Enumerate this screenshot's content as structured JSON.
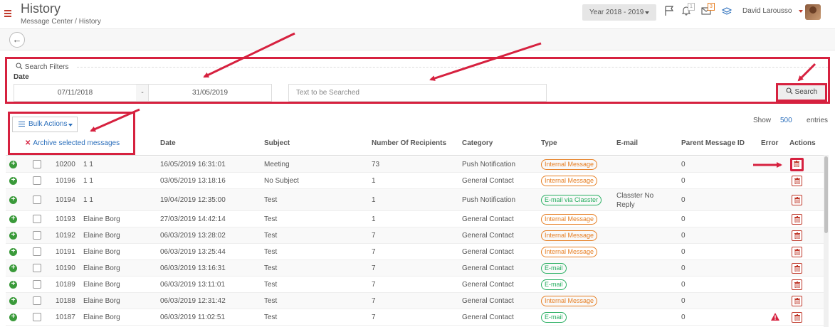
{
  "header": {
    "title": "History",
    "breadcrumb": "Message Center / History",
    "year_select": "Year 2018 - 2019",
    "notif_count": "1",
    "msg_count": "3",
    "user_name": "David Larousso"
  },
  "filters": {
    "label": "Search Filters",
    "date_label": "Date",
    "date_from": "07/11/2018",
    "date_sep": "-",
    "date_to": "31/05/2019",
    "text_placeholder": "Text to be Searched",
    "search_button": "Search"
  },
  "bulk": {
    "button": "Bulk Actions",
    "archive": "Archive selected messages"
  },
  "entries": {
    "show": "Show",
    "count": "500",
    "entries": "entries"
  },
  "table": {
    "headers": {
      "date": "Date",
      "subject": "Subject",
      "recipients": "Number Of Recipients",
      "category": "Category",
      "type": "Type",
      "email": "E-mail",
      "parent": "Parent Message ID",
      "error": "Error",
      "actions": "Actions"
    },
    "rows": [
      {
        "id": "10200",
        "sender": "1 1",
        "date": "16/05/2019 16:31:01",
        "subject": "Meeting",
        "recipients": "73",
        "category": "Push Notification",
        "type": "Internal Message",
        "email": "",
        "parent": "0"
      },
      {
        "id": "10196",
        "sender": "1 1",
        "date": "03/05/2019 13:18:16",
        "subject": "No Subject",
        "recipients": "1",
        "category": "General Contact",
        "type": "Internal Message",
        "email": "",
        "parent": "0"
      },
      {
        "id": "10194",
        "sender": "1 1",
        "date": "19/04/2019 12:35:00",
        "subject": "Test",
        "recipients": "1",
        "category": "Push Notification",
        "type": "E-mail via Classter",
        "email": "Classter No Reply",
        "parent": "0"
      },
      {
        "id": "10193",
        "sender": "Elaine Borg",
        "date": "27/03/2019 14:42:14",
        "subject": "Test",
        "recipients": "1",
        "category": "General Contact",
        "type": "Internal Message",
        "email": "",
        "parent": "0"
      },
      {
        "id": "10192",
        "sender": "Elaine Borg",
        "date": "06/03/2019 13:28:02",
        "subject": "Test",
        "recipients": "7",
        "category": "General Contact",
        "type": "Internal Message",
        "email": "",
        "parent": "0"
      },
      {
        "id": "10191",
        "sender": "Elaine Borg",
        "date": "06/03/2019 13:25:44",
        "subject": "Test",
        "recipients": "7",
        "category": "General Contact",
        "type": "Internal Message",
        "email": "",
        "parent": "0"
      },
      {
        "id": "10190",
        "sender": "Elaine Borg",
        "date": "06/03/2019 13:16:31",
        "subject": "Test",
        "recipients": "7",
        "category": "General Contact",
        "type": "E-mail",
        "email": "",
        "parent": "0"
      },
      {
        "id": "10189",
        "sender": "Elaine Borg",
        "date": "06/03/2019 13:11:01",
        "subject": "Test",
        "recipients": "7",
        "category": "General Contact",
        "type": "E-mail",
        "email": "",
        "parent": "0"
      },
      {
        "id": "10188",
        "sender": "Elaine Borg",
        "date": "06/03/2019 12:31:42",
        "subject": "Test",
        "recipients": "7",
        "category": "General Contact",
        "type": "Internal Message",
        "email": "",
        "parent": "0"
      },
      {
        "id": "10187",
        "sender": "Elaine Borg",
        "date": "06/03/2019 11:02:51",
        "subject": "Test",
        "recipients": "7",
        "category": "General Contact",
        "type": "E-mail",
        "email": "",
        "parent": "0",
        "error": true
      }
    ]
  },
  "colors": {
    "highlight": "#d6213f",
    "orange_badge": "#e67e22",
    "green_badge": "#27ae60",
    "link": "#2a6ebb"
  }
}
